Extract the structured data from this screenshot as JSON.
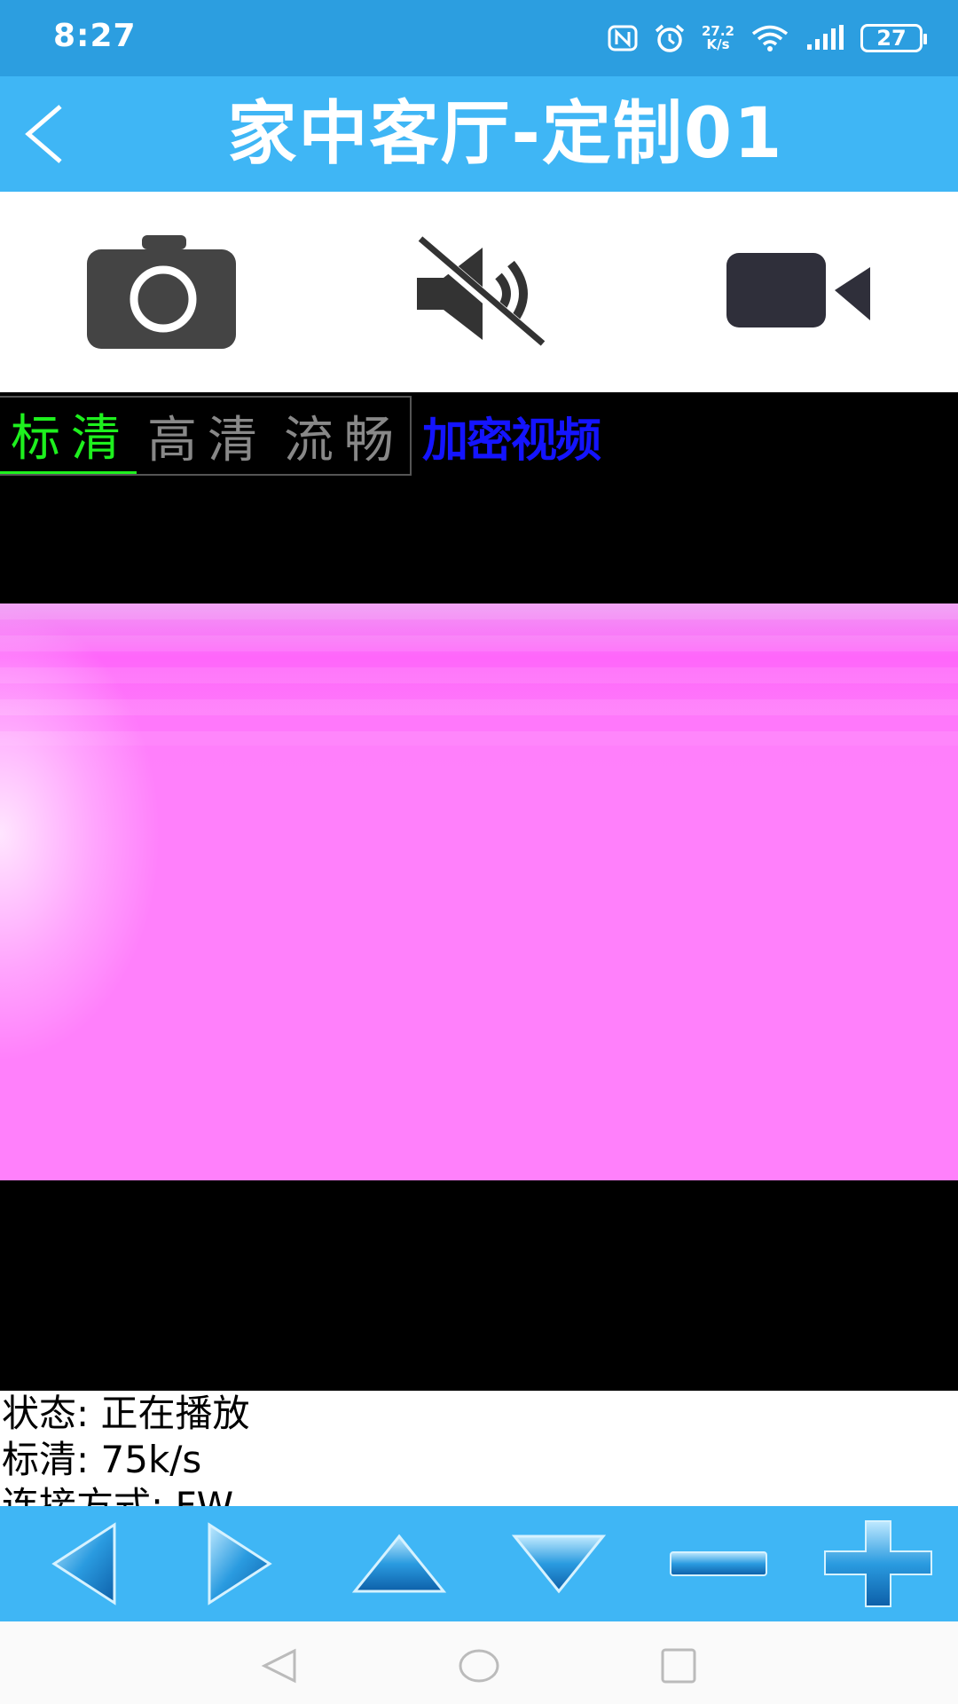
{
  "status_bar": {
    "time": "8:27",
    "net_speed_value": "27.2",
    "net_speed_unit": "K/s",
    "battery": "27",
    "icons": [
      "nfc-icon",
      "alarm-icon",
      "wifi-icon",
      "signal-icon",
      "battery-icon"
    ]
  },
  "header": {
    "title": "家中客厅-定制01",
    "back_icon": "chevron-left-icon"
  },
  "toolbar": {
    "buttons": [
      "camera-icon",
      "mute-icon",
      "video-camera-icon"
    ]
  },
  "video": {
    "quality_tabs": [
      {
        "label": "标清",
        "active": true
      },
      {
        "label": "高清",
        "active": false
      },
      {
        "label": "流畅",
        "active": false
      }
    ],
    "encrypt_label": "加密视频"
  },
  "info": {
    "status_line": "状态: 正在播放",
    "bitrate_line": "标清: 75k/s",
    "connection_line": "连接方式: FW"
  },
  "ptz": {
    "buttons": [
      "arrow-left-icon",
      "arrow-right-icon",
      "arrow-up-icon",
      "arrow-down-icon",
      "zoom-out-icon",
      "zoom-in-icon"
    ]
  },
  "nav": {
    "buttons": [
      "nav-back-icon",
      "nav-home-icon",
      "nav-recent-icon"
    ]
  },
  "colors": {
    "status_bar": "#2c9ee0",
    "title_bar": "#3fb6f5",
    "active_tab": "#1ef01e",
    "encrypt_text": "#1414ff",
    "video_frame": "#ff80fb"
  }
}
